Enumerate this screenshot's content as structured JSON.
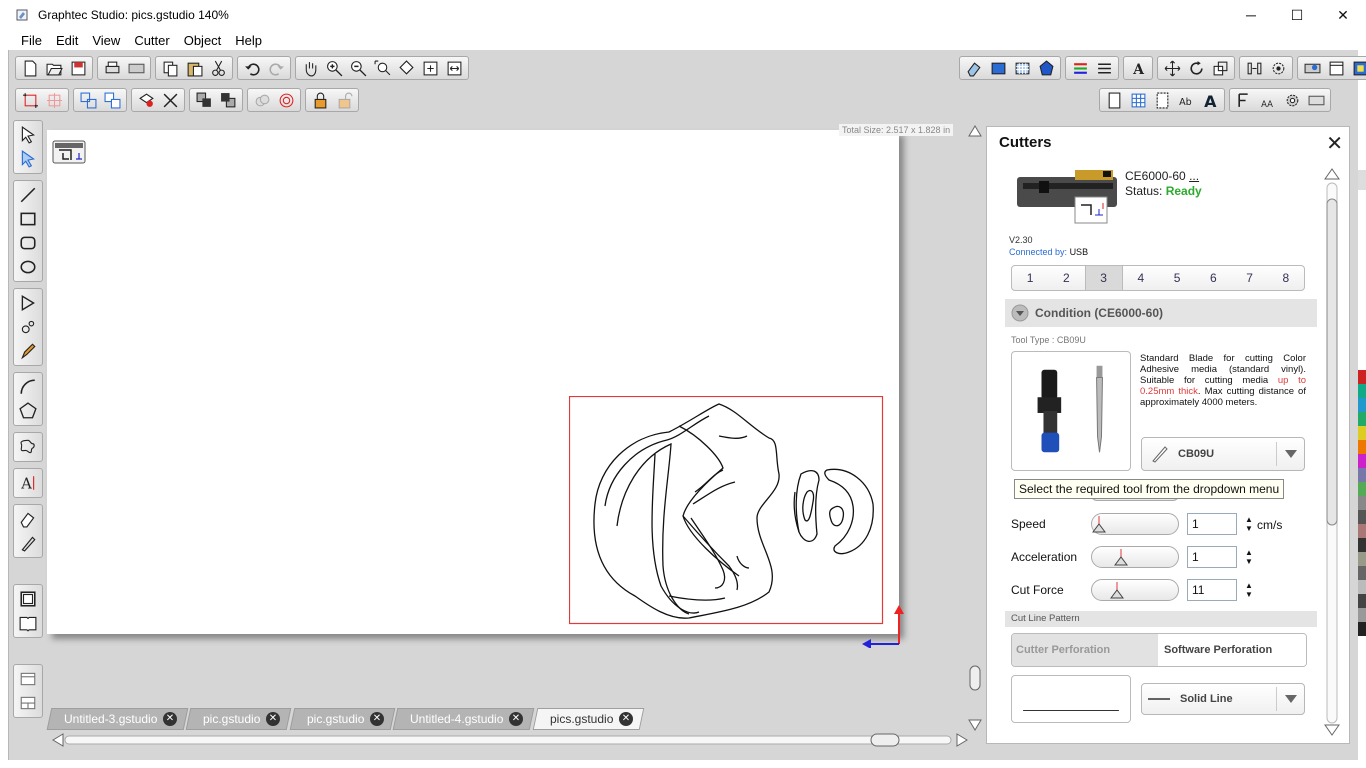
{
  "window": {
    "title": "Graphtec Studio: pics.gstudio 140%",
    "minimize": "─",
    "maximize": "☐",
    "close": "✕"
  },
  "menu": [
    "File",
    "Edit",
    "View",
    "Cutter",
    "Object",
    "Help"
  ],
  "canvas": {
    "total_size": "Total Size: 2.517 x 1.828 in"
  },
  "tabs": [
    {
      "label": "Untitled-3.gstudio",
      "active": false
    },
    {
      "label": "pic.gstudio",
      "active": false
    },
    {
      "label": "pic.gstudio",
      "active": false
    },
    {
      "label": "Untitled-4.gstudio",
      "active": false
    },
    {
      "label": "pics.gstudio",
      "active": true
    }
  ],
  "cutters_panel": {
    "title": "Cutters",
    "device_name": "CE6000-60",
    "device_more": "...",
    "status_label": "Status:",
    "status_value": "Ready",
    "status_color": "#2eaa2e",
    "version": "V2.30",
    "connected_label": "Connected by:",
    "connected_value": "USB",
    "condition_tabs": [
      "1",
      "2",
      "3",
      "4",
      "5",
      "6",
      "7",
      "8"
    ],
    "active_condition": "3",
    "condition_header": "Condition (CE6000-60)",
    "tool_type": "Tool Type : CB09U",
    "tool_description_a": "Standard Blade for cutting Color Adhesive media (standard vinyl). Suitable for cutting media ",
    "tool_description_highlight": "up to 0.25mm thick",
    "tool_description_b": ". Max cutting distance of approximately 4000 meters.",
    "tool_dropdown_value": "CB09U",
    "tooltip": "Select the required tool from the dropdown menu",
    "speed_label": "Speed",
    "speed_value": "1",
    "speed_unit": "cm/s",
    "acceleration_label": "Acceleration",
    "acceleration_value": "1",
    "cut_force_label": "Cut Force",
    "cut_force_value": "11",
    "cut_line_pattern_label": "Cut Line Pattern",
    "cutter_perforation": "Cutter Perforation",
    "software_perforation": "Software Perforation",
    "line_dropdown_value": "Solid Line"
  }
}
